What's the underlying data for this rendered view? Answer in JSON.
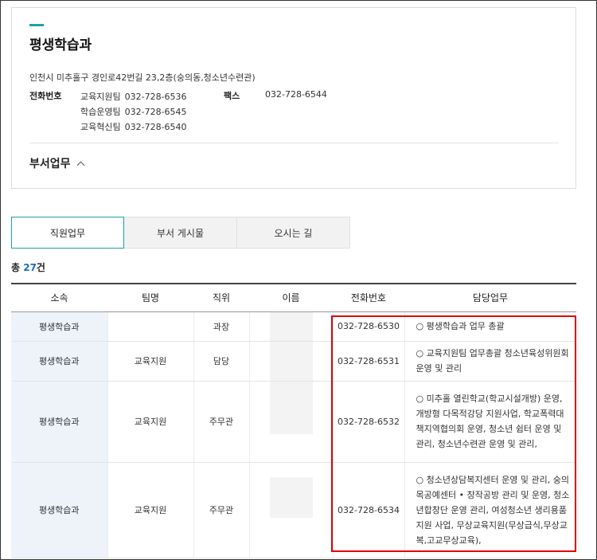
{
  "department": {
    "title": "평생학습과",
    "address": "인천시 미추홀구 경인로42번길 23,2층(숭의동,청소년수련관)",
    "contact_label": "전화번호",
    "phones": [
      {
        "team": "교육지원팀",
        "number": "032-728-6536"
      },
      {
        "team": "학습운영팀",
        "number": "032-728-6545"
      },
      {
        "team": "교육혁신팀",
        "number": "032-728-6540"
      }
    ],
    "fax_label": "팩스",
    "fax": "032-728-6544",
    "duties_toggle": "부서업무"
  },
  "tabs": [
    {
      "label": "직원업무",
      "active": true
    },
    {
      "label": "부서 게시물",
      "active": false
    },
    {
      "label": "오시는 길",
      "active": false
    }
  ],
  "total": {
    "prefix": "총 ",
    "count": "27",
    "suffix": "건"
  },
  "table": {
    "headers": [
      "소속",
      "팀명",
      "직위",
      "이름",
      "전화번호",
      "담당업무"
    ],
    "rows": [
      {
        "org": "평생학습과",
        "team": "",
        "position": "과장",
        "phone": "032-728-6530",
        "duties": "○ 평생학습과 업무 총괄"
      },
      {
        "org": "평생학습과",
        "team": "교육지원",
        "position": "담당",
        "phone": "032-728-6531",
        "duties": "○ 교육지원팀 업무총괄 청소년육성위원회 운영 및 관리"
      },
      {
        "org": "평생학습과",
        "team": "교육지원",
        "position": "주무관",
        "phone": "032-728-6532",
        "duties": "○ 미추홀 열린학교(학교시설개방) 운영, 개방형 다목적강당 지원사업, 학교폭력대책지역협의회 운영, 청소년 쉼터 운영 및 관리, 청소년수련관 운영 및 관리,"
      },
      {
        "org": "평생학습과",
        "team": "교육지원",
        "position": "주무관",
        "phone": "032-728-6534",
        "duties": "○ 청소년상담복지센터 운영 및 관리, 숭의목공예센터 • 창작공방 관리 및 운영, 청소년합창단 운영 관리, 여성청소년 생리용품 지원 사업, 무상교육지원(무상급식,무상교복,고교무상교육),"
      }
    ]
  },
  "colors": {
    "accent": "#1aa3a3",
    "highlight": "#e00000",
    "count": "#1a6fb7"
  }
}
